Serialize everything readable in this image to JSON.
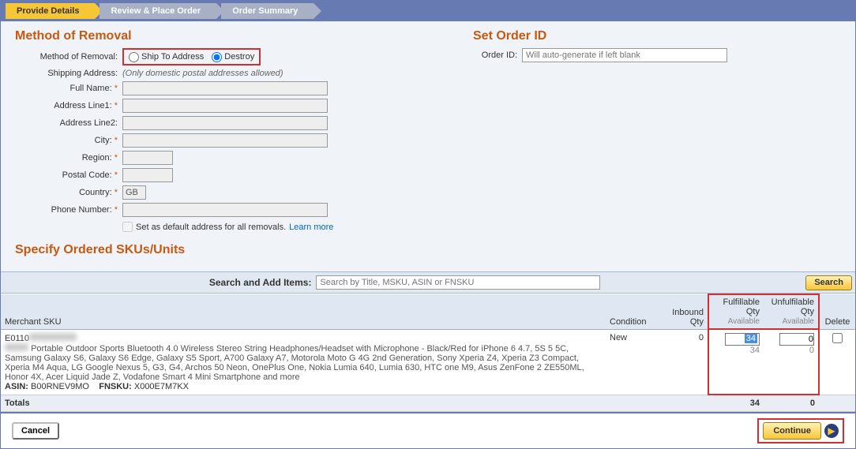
{
  "steps": {
    "s0": "Provide Details",
    "s1": "Review & Place Order",
    "s2": "Order Summary"
  },
  "sections": {
    "removal": "Method of Removal",
    "order": "Set Order ID",
    "skus": "Specify Ordered SKUs/Units"
  },
  "removal": {
    "method_label": "Method of Removal:",
    "ship_label": "Ship To Address",
    "destroy_label": "Destroy",
    "shipping_address_label": "Shipping Address:",
    "shipping_address_note": "(Only domestic postal addresses allowed)",
    "full_name_label": "Full Name:",
    "addr1_label": "Address Line1:",
    "addr2_label": "Address Line2:",
    "city_label": "City:",
    "region_label": "Region:",
    "postal_label": "Postal Code:",
    "country_label": "Country:",
    "country_value": "GB",
    "phone_label": "Phone Number:",
    "default_label": "Set as default address for all removals.",
    "learn_more": "Learn more"
  },
  "order": {
    "id_label": "Order ID:",
    "id_placeholder": "Will auto-generate if left blank"
  },
  "search": {
    "label": "Search and Add Items:",
    "placeholder": "Search by Title, MSKU, ASIN or FNSKU",
    "button": "Search"
  },
  "table": {
    "headers": {
      "msku": "Merchant SKU",
      "condition": "Condition",
      "inbound": "Inbound Qty",
      "fulfillable_l1": "Fulfillable Qty",
      "fulfillable_l2": "Available",
      "unfulfillable_l1": "Unfulfilable Qty",
      "unfulfillable_l2": "Available",
      "delete": "Delete"
    },
    "row": {
      "sku": "E0110",
      "desc": "Portable Outdoor Sports Bluetooth 4.0 Wireless Stereo String Headphones/Headset with Microphone - Black/Red for iPhone 6 4.7, 5S 5 5C, Samsung Galaxy S6, Galaxy S6 Edge, Galaxy S5 Sport, A700 Galaxy A7, Motorola Moto G 4G 2nd Generation, Sony Xperia Z4, Xperia Z3 Compact, Xperia M4 Aqua, LG Google Nexus 5, G3, G4, Archos 50 Neon, OnePlus One, Nokia Lumia 640, Lumia 630, HTC one M9, Asus ZenFone 2 ZE550ML, Honor 4X, Acer Liquid Jade Z, Vodafone Smart 4 Mini Smartphone and more",
      "asin_label": "ASIN:",
      "asin": "B00RNEV9MO",
      "fnsku_label": "FNSKU:",
      "fnsku": "X000E7M7KX",
      "condition": "New",
      "inbound": "0",
      "fulfillable_input": "34",
      "fulfillable_avail": "34",
      "unfulfillable_input": "0",
      "unfulfillable_avail": "0"
    },
    "totals": {
      "label": "Totals",
      "fulfillable": "34",
      "unfulfillable": "0"
    }
  },
  "buttons": {
    "cancel": "Cancel",
    "continue": "Continue"
  },
  "colors": {
    "accent": "#c65a11",
    "highlight": "#d03030",
    "step_active": "#f7c637",
    "header_bar": "#677bb2"
  }
}
